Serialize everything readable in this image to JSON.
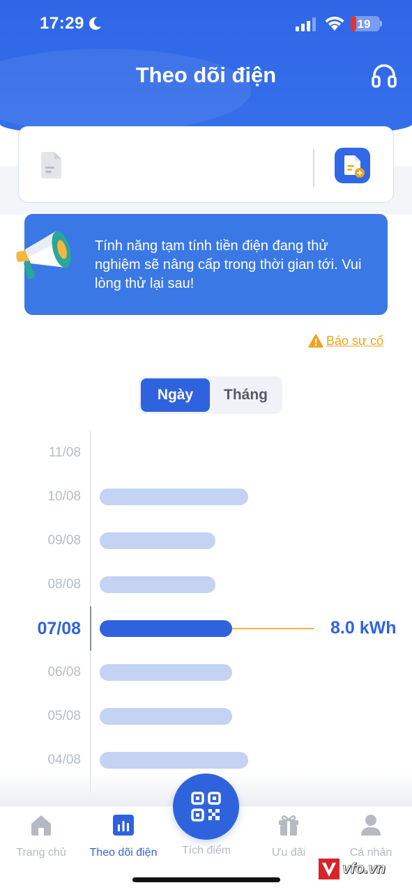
{
  "status_bar": {
    "time": "17:29",
    "battery": "19"
  },
  "header": {
    "title": "Theo dõi điện"
  },
  "account_card": {
    "value": ""
  },
  "notice": {
    "text": "Tính năng tạm tính tiền điện đang thử nghiệm sẽ nâng cấp trong thời gian tới. Vui lòng thử lại sau!"
  },
  "report_link": {
    "label": "Báo sự cố"
  },
  "toggle": {
    "day_label": "Ngày",
    "month_label": "Tháng",
    "selected": "Ngày"
  },
  "chart_data": {
    "type": "bar",
    "orientation": "horizontal",
    "categories": [
      "11/08",
      "10/08",
      "09/08",
      "08/08",
      "07/08",
      "06/08",
      "05/08",
      "04/08"
    ],
    "values": [
      0,
      9.0,
      7.0,
      7.0,
      8.0,
      8.0,
      8.0,
      9.0
    ],
    "unit": "kWh",
    "selected_category": "07/08",
    "selected_value_label": "8.0 kWh"
  },
  "bottom_nav": {
    "items": [
      {
        "label": "Trang chủ",
        "icon": "home-icon",
        "active": false
      },
      {
        "label": "Theo dõi điện",
        "icon": "chart-icon",
        "active": true
      },
      {
        "label": "Tích điểm",
        "icon": "qr-code-icon",
        "active": false
      },
      {
        "label": "Ưu đãi",
        "icon": "gift-icon",
        "active": false
      },
      {
        "label": "Cá nhân",
        "icon": "user-icon",
        "active": false
      }
    ]
  },
  "watermark": {
    "text": "vfo.vn"
  },
  "colors": {
    "primary": "#2f63de",
    "accent": "#f3b536",
    "bar_inactive": "#c4d2f3",
    "warning": "#f2a31b"
  }
}
